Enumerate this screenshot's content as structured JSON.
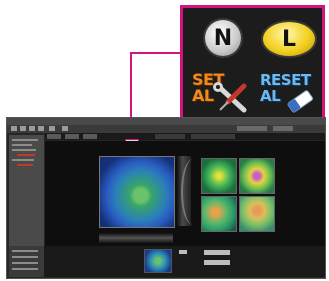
{
  "callout": {
    "buttons": [
      {
        "name": "normal",
        "label": "N"
      },
      {
        "name": "lens",
        "label": "L"
      },
      {
        "name": "set-al",
        "label_line1": "SET",
        "label_line2": "AL"
      },
      {
        "name": "reset-al",
        "label_line1": "RESET",
        "label_line2": "AL"
      }
    ]
  },
  "colors": {
    "accent": "#d4147e",
    "window_bg": "#262626",
    "set_text": "#f08a1c",
    "reset_text": "#6eb8f0",
    "lens_button": "#f2d020"
  },
  "icons": [
    "wrench-screwdriver-icon",
    "eraser-icon",
    "toolbar-icon"
  ]
}
